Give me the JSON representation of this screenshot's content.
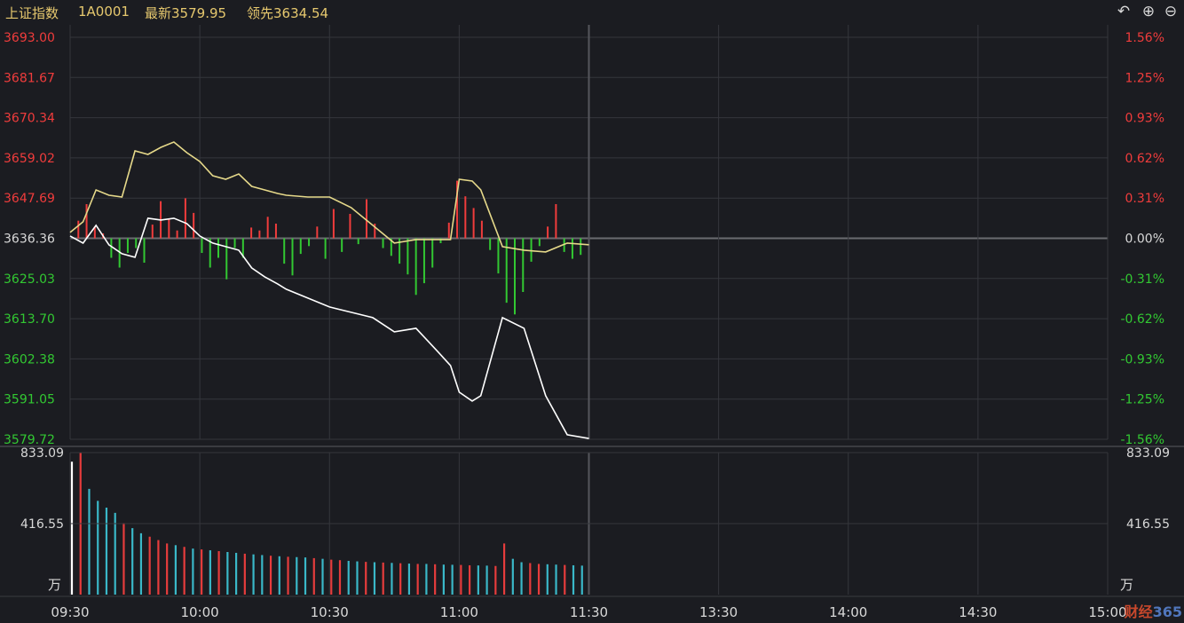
{
  "header": {
    "title": "上证指数",
    "code": "1A0001",
    "latest_label": "最新",
    "latest_value": "3579.95",
    "leading_label": "领先",
    "leading_value": "3634.54"
  },
  "toolbar": {
    "back_icon": "undo-icon",
    "zoom_in_icon": "zoom-in-icon",
    "zoom_out_icon": "zoom-out-icon"
  },
  "watermark": {
    "prefix": "财经",
    "suffix": "365"
  },
  "colors": {
    "up": "#f03c3c",
    "down": "#32c832",
    "price_line": "#ffffff",
    "leading_line": "#e6d98a",
    "volume_up": "#e63c3c",
    "volume_down": "#3ab8c8",
    "grid": "#35363c",
    "neutral_text": "#d8d8d8"
  },
  "chart_data": {
    "type": "line",
    "title": "",
    "time_labels": [
      "09:30",
      "10:00",
      "10:30",
      "11:00",
      "11:30",
      "13:30",
      "14:00",
      "14:30",
      "15:00"
    ],
    "price_axis": {
      "prev_close": 3636.36,
      "ylim": [
        3579.72,
        3693.0
      ],
      "ticks_left": [
        "3693.00",
        "3681.67",
        "3670.34",
        "3659.02",
        "3647.69",
        "3636.36",
        "3625.03",
        "3613.70",
        "3602.38",
        "3591.05",
        "3579.72"
      ],
      "ticks_right": [
        "1.56%",
        "1.25%",
        "0.93%",
        "0.62%",
        "0.31%",
        "0.00%",
        "-0.31%",
        "-0.62%",
        "-0.93%",
        "-1.25%",
        "-1.56%"
      ]
    },
    "volume_axis": {
      "ylim": [
        0,
        833.09
      ],
      "ticks": [
        "833.09",
        "416.55"
      ],
      "unit": "万"
    },
    "series": [
      {
        "x": [
          0,
          3,
          6,
          9,
          12,
          15,
          18,
          21,
          24,
          27,
          30,
          33,
          36,
          39,
          42,
          45,
          48,
          50,
          55,
          60,
          65,
          70,
          75,
          80,
          85,
          88,
          90,
          93,
          95,
          100,
          105,
          110,
          115,
          120
        ],
        "values": [
          3637.0,
          3635.0,
          3640.0,
          3634.5,
          3632.0,
          3631.0,
          3642.0,
          3641.5,
          3642.0,
          3640.5,
          3637.0,
          3635.0,
          3634.0,
          3633.0,
          3628.0,
          3625.5,
          3623.5,
          3622.0,
          3619.5,
          3617.0,
          3615.5,
          3614.0,
          3610.0,
          3611.0,
          3604.5,
          3600.5,
          3593.0,
          3590.5,
          3592.0,
          3614.0,
          3611.0,
          3592.0,
          3581.0,
          3579.95
        ]
      },
      {
        "x": [
          0,
          3,
          6,
          9,
          12,
          15,
          18,
          21,
          24,
          27,
          30,
          33,
          36,
          39,
          42,
          45,
          48,
          50,
          55,
          60,
          65,
          70,
          75,
          80,
          85,
          88,
          90,
          93,
          95,
          100,
          105,
          110,
          115,
          120
        ],
        "values": [
          3638.0,
          3641.0,
          3650.0,
          3648.5,
          3648.0,
          3661.0,
          3660.0,
          3662.0,
          3663.5,
          3660.5,
          3658.0,
          3654.0,
          3653.0,
          3654.5,
          3651.0,
          3650.0,
          3649.0,
          3648.5,
          3648.0,
          3648.0,
          3645.0,
          3640.0,
          3635.0,
          3636.0,
          3636.0,
          3636.0,
          3653.0,
          3652.5,
          3650.0,
          3634.0,
          3633.0,
          3632.5,
          3635.0,
          3634.54
        ]
      }
    ],
    "leading_bars": [
      1.8,
      3.5,
      1.2,
      0.5,
      -2,
      -3,
      -1.5,
      -1,
      -2.5,
      1.4,
      3.8,
      2,
      0.8,
      4.1,
      2.6,
      -1.5,
      -3,
      -2,
      -4.2,
      -1,
      -2,
      1.1,
      0.8,
      2.2,
      1.5,
      -2.6,
      -3.8,
      -1.6,
      -0.8,
      1.2,
      -2.1,
      3,
      -1.4,
      2.5,
      -0.6,
      4,
      1.5,
      -1,
      -1.8,
      -2.6,
      -3.7,
      -5.8,
      -4.6,
      -3,
      -0.5,
      1.6,
      5.9,
      4.3,
      3.1,
      1.8,
      -1.2,
      -3.6,
      -6.6,
      -7.8,
      -5.5,
      -2.4,
      -0.8,
      1.2,
      3.5,
      -1.4,
      -2.1,
      -1.7
    ],
    "volume": [
      780,
      833,
      620,
      550,
      510,
      480,
      420,
      390,
      360,
      340,
      320,
      300,
      290,
      280,
      270,
      265,
      260,
      255,
      250,
      245,
      240,
      236,
      232,
      228,
      225,
      222,
      220,
      218,
      214,
      210,
      205,
      202,
      198,
      195,
      192,
      190,
      188,
      186,
      184,
      182,
      180,
      180,
      178,
      176,
      175,
      174,
      172,
      171,
      170,
      168,
      300,
      210,
      190,
      185,
      180,
      178,
      176,
      174,
      172,
      170
    ],
    "volume_colors": [
      "w",
      "u",
      "d",
      "d",
      "d",
      "d",
      "u",
      "d",
      "d",
      "u",
      "u",
      "u",
      "d",
      "u",
      "d",
      "u",
      "d",
      "u",
      "d",
      "d",
      "u",
      "d",
      "d",
      "u",
      "d",
      "u",
      "d",
      "d",
      "u",
      "d",
      "u",
      "u",
      "d",
      "d",
      "u",
      "d",
      "u",
      "d",
      "u",
      "d",
      "u",
      "d",
      "u",
      "d",
      "d",
      "u",
      "u",
      "d",
      "d",
      "u",
      "u",
      "d",
      "d",
      "u",
      "u",
      "d",
      "d",
      "u",
      "d",
      "d"
    ]
  }
}
